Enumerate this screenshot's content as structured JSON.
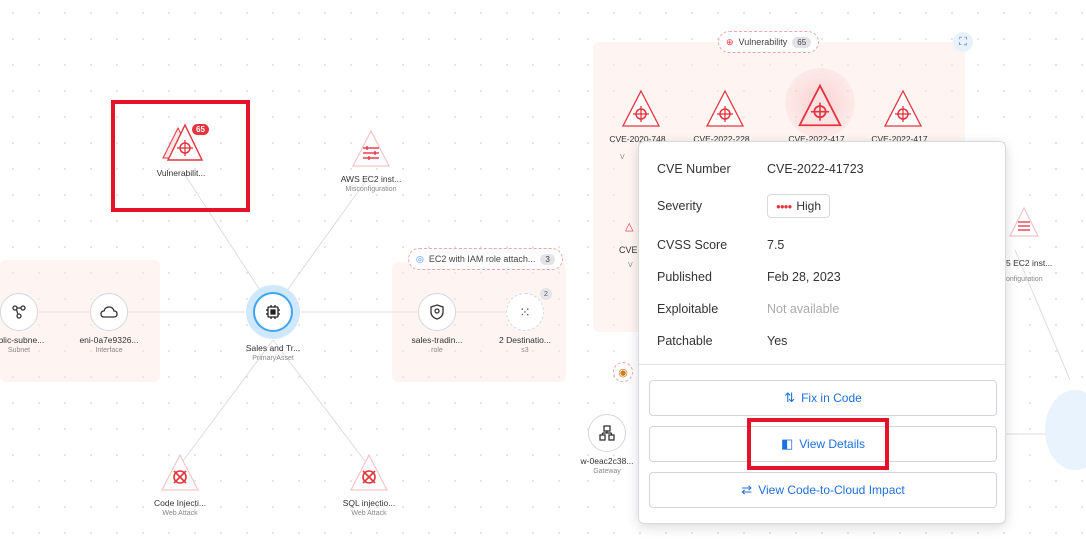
{
  "left": {
    "nodes": {
      "vulnerability": {
        "label": "Vulnerabilit...",
        "badge": "65"
      },
      "aws_ec2": {
        "label": "AWS EC2 inst...",
        "sub": "Misconfiguration"
      },
      "subnet": {
        "label": "ublic-subne...",
        "sub": "Subnet"
      },
      "interface": {
        "label": "eni-0a7e9326...",
        "sub": "Interface"
      },
      "primary": {
        "label": "Sales and Tr...",
        "sub": "PrimaryAsset"
      },
      "role": {
        "label": "sales-tradin...",
        "sub": "role"
      },
      "s3": {
        "label": "2 Destinatio...",
        "sub": "s3",
        "count": "2"
      },
      "code_injection": {
        "label": "Code Injecti...",
        "sub": "Web Attack"
      },
      "sql_injection": {
        "label": "SQL injectio...",
        "sub": "Web Attack"
      }
    },
    "group_pill": {
      "label": "EC2 with IAM role attach...",
      "count": "3"
    }
  },
  "right": {
    "vuln_pill": {
      "label": "Vulnerability",
      "count": "65"
    },
    "cves": [
      "CVE-2020-748...",
      "CVE-2022-228...",
      "CVE-2022-417...",
      "CVE-2022-417..."
    ],
    "partial_cve": "CVE",
    "partial_v": "V",
    "aws_partial": {
      "label": "5 EC2 inst...",
      "sub": "onfiguration"
    },
    "gateway": {
      "label": "w-0eac2c38...",
      "sub": "Gateway"
    },
    "details": {
      "cve_number_label": "CVE Number",
      "cve_number": "CVE-2022-41723",
      "severity_label": "Severity",
      "severity": "High",
      "cvss_label": "CVSS Score",
      "cvss": "7.5",
      "published_label": "Published",
      "published": "Feb 28, 2023",
      "exploitable_label": "Exploitable",
      "exploitable": "Not available",
      "patchable_label": "Patchable",
      "patchable": "Yes"
    },
    "buttons": {
      "fix": "Fix in Code",
      "view": "View Details",
      "impact": "View Code-to-Cloud Impact"
    }
  },
  "colors": {
    "accent": "#1f6fe0",
    "danger": "#e5343e",
    "highlight": "#e5122a"
  }
}
